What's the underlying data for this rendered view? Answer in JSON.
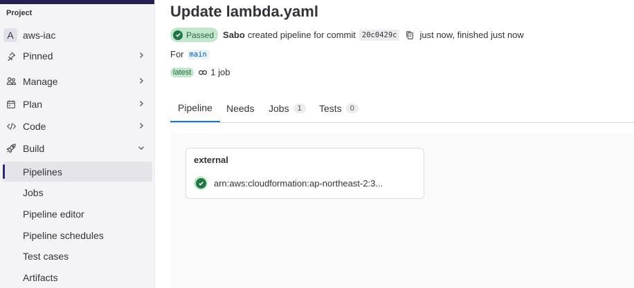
{
  "sidebar": {
    "section_title": "Project",
    "project": {
      "avatar_letter": "A",
      "name": "aws-iac"
    },
    "items": [
      {
        "label": "Pinned",
        "icon": "pin-icon"
      },
      {
        "label": "Manage",
        "icon": "users-icon"
      },
      {
        "label": "Plan",
        "icon": "calendar-icon"
      },
      {
        "label": "Code",
        "icon": "code-icon"
      },
      {
        "label": "Build",
        "icon": "rocket-icon"
      }
    ],
    "build_sub": [
      {
        "label": "Pipelines"
      },
      {
        "label": "Jobs"
      },
      {
        "label": "Pipeline editor"
      },
      {
        "label": "Pipeline schedules"
      },
      {
        "label": "Test cases"
      },
      {
        "label": "Artifacts"
      }
    ]
  },
  "main": {
    "title": "Update lambda.yaml",
    "status": "Passed",
    "author": "Sabo",
    "created_text": "created pipeline for commit",
    "commit_sha": "20c0429c",
    "time_text": "just now, finished just now",
    "for_label": "For",
    "branch": "main",
    "tag": "latest",
    "jobs_count_text": "1 job",
    "tabs": [
      {
        "label": "Pipeline"
      },
      {
        "label": "Needs"
      },
      {
        "label": "Jobs",
        "count": "1"
      },
      {
        "label": "Tests",
        "count": "0"
      }
    ],
    "stage": {
      "title": "external",
      "job_name": "arn:aws:cloudformation:ap-northeast-2:3..."
    }
  },
  "colors": {
    "accent": "#1f75cb",
    "success": "#217645",
    "success_bg": "#c3e6cd",
    "topbar": "#232150"
  }
}
